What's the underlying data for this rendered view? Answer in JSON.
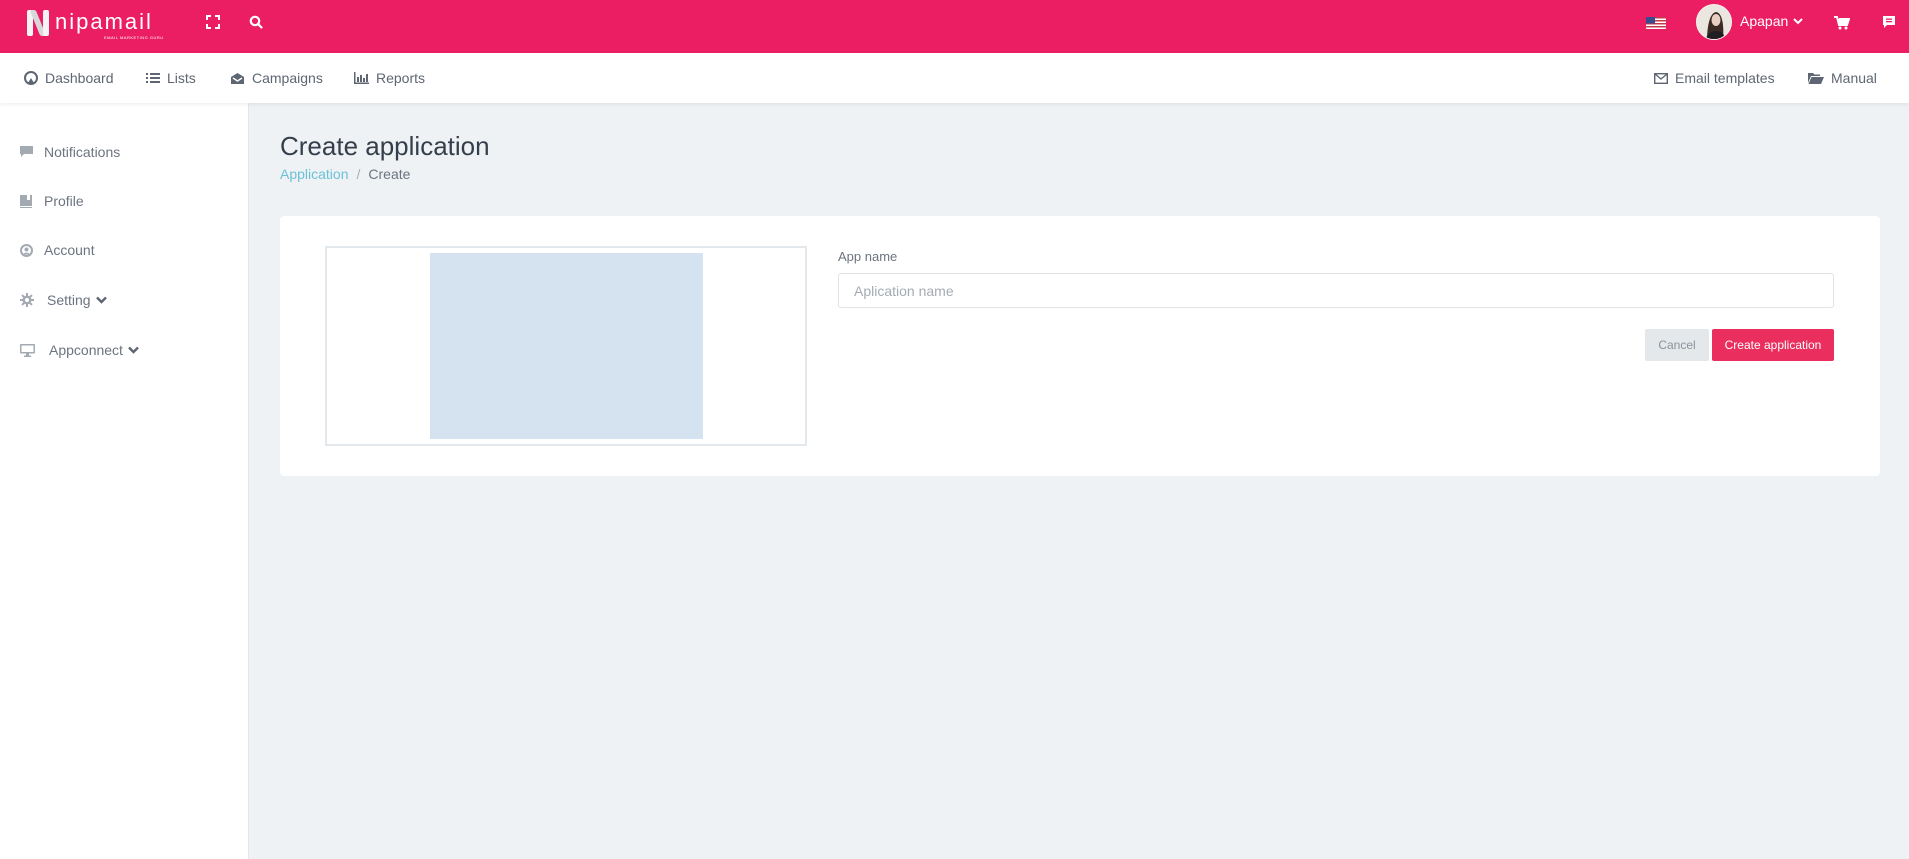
{
  "brand": {
    "name": "nipamail",
    "tagline": "EMAIL MARKETING GURU",
    "accent_color": "#ec1e63"
  },
  "topbar": {
    "icons": [
      "expand-icon",
      "search-icon"
    ],
    "language_flag": "us-flag",
    "user": {
      "name": "Apapan"
    },
    "right_icons": [
      "cart-icon",
      "chat-icon"
    ]
  },
  "menu": {
    "left": [
      {
        "label": "Dashboard",
        "icon": "dashboard-icon"
      },
      {
        "label": "Lists",
        "icon": "list-icon"
      },
      {
        "label": "Campaigns",
        "icon": "envelope-open-icon"
      },
      {
        "label": "Reports",
        "icon": "bar-chart-icon"
      }
    ],
    "right": [
      {
        "label": "Email templates",
        "icon": "envelope-icon"
      },
      {
        "label": "Manual",
        "icon": "folder-open-icon"
      }
    ]
  },
  "sidebar": {
    "items": [
      {
        "label": "Notifications",
        "icon": "comment-icon"
      },
      {
        "label": "Profile",
        "icon": "book-icon"
      },
      {
        "label": "Account",
        "icon": "user-circle-icon"
      },
      {
        "label": "Setting",
        "icon": "gear-icon",
        "expandable": true
      },
      {
        "label": "Appconnect",
        "icon": "desktop-icon",
        "expandable": true
      }
    ]
  },
  "page": {
    "title": "Create application",
    "breadcrumb": [
      {
        "label": "Application",
        "link": true
      },
      {
        "label": "/"
      },
      {
        "label": "Create"
      }
    ]
  },
  "form": {
    "app_name_label": "App name",
    "app_name_value": "",
    "app_name_placeholder": "Aplication name",
    "cancel_label": "Cancel",
    "submit_label": "Create application"
  }
}
